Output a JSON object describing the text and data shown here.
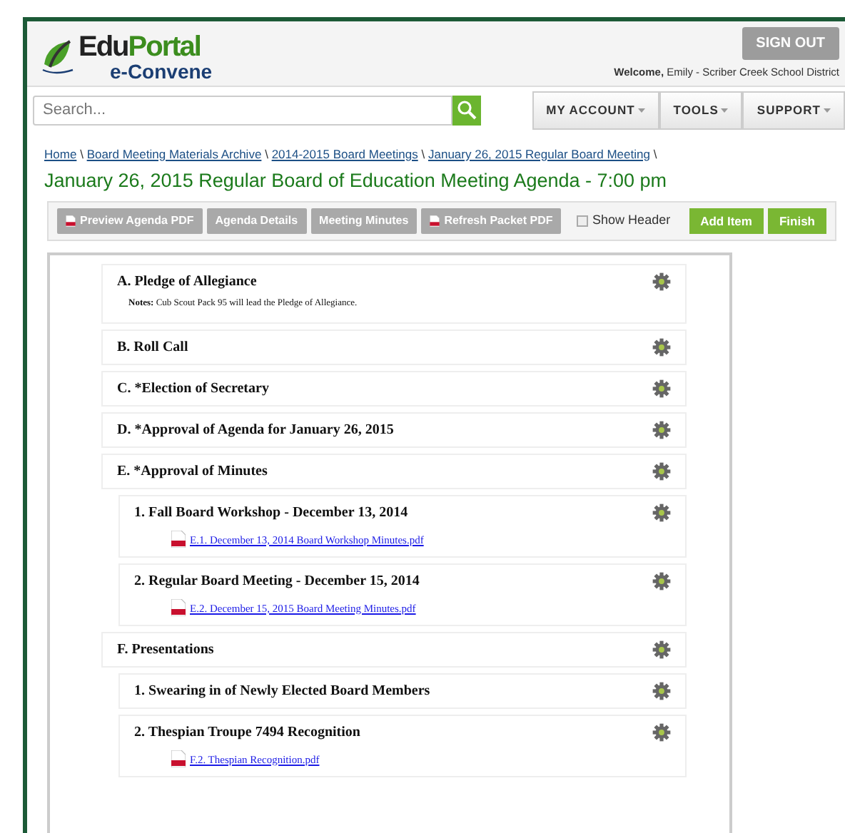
{
  "header": {
    "logo": {
      "name_start": "Edu",
      "name_end": "Portal",
      "tagline": "e-Convene"
    },
    "sign_out": "SIGN OUT",
    "welcome": "**Welcome,** Emily - Scriber Creek School District"
  },
  "search": {
    "placeholder": "Search..."
  },
  "menus": [
    {
      "label": "MY ACCOUNT"
    },
    {
      "label": "TOOLS"
    },
    {
      "label": "SUPPORT"
    }
  ],
  "breadcrumb": [
    {
      "label": "Home",
      "separator": "\\"
    },
    {
      "label": "Board Meeting Materials Archive",
      "separator": "\\"
    },
    {
      "label": "2014-2015 Board Meetings",
      "separator": "\\"
    },
    {
      "label": "January 26, 2015 Regular Board Meeting",
      "separator": "\\"
    }
  ],
  "title": "January 26, 2015 Regular Board of Education Meeting Agenda - 7:00 pm",
  "toolbar": {
    "buttons": [
      {
        "label": "Preview Agenda PDF",
        "kind": "pdf"
      },
      {
        "label": "Agenda Details",
        "kind": "plain"
      },
      {
        "label": "Meeting Minutes",
        "kind": "plain"
      },
      {
        "label": "Refresh Packet PDF",
        "kind": "pdf"
      }
    ],
    "show_header": {
      "label": "Show Header",
      "checked": false
    },
    "actions": [
      "Add Item",
      "Finish"
    ]
  },
  "agenda": [
    {
      "title": "A. Pledge of Allegiance",
      "notes": "**Notes:** Cub Scout Pack 95 will lead the Pledge of Allegiance."
    },
    {
      "title": "B. Roll Call"
    },
    {
      "title": "C. *Election of Secretary"
    },
    {
      "title": "D. *Approval of Agenda for January 26, 2015"
    },
    {
      "title": "E. *Approval of Minutes",
      "children": [
        {
          "title": "1. Fall Board Workshop - December 13, 2014",
          "files": [
            "E.1. December 13, 2014 Board Workshop Minutes.pdf"
          ]
        },
        {
          "title": "2. Regular Board Meeting - December 15, 2014",
          "files": [
            "E.2. December 15, 2015 Board Meeting Minutes.pdf"
          ]
        }
      ]
    },
    {
      "title": "F. Presentations",
      "children": [
        {
          "title": "1. Swearing in of Newly Elected Board Members"
        },
        {
          "title": "2. Thespian Troupe 7494 Recognition",
          "files": [
            "F.2. Thespian Recognition.pdf"
          ]
        }
      ]
    }
  ]
}
